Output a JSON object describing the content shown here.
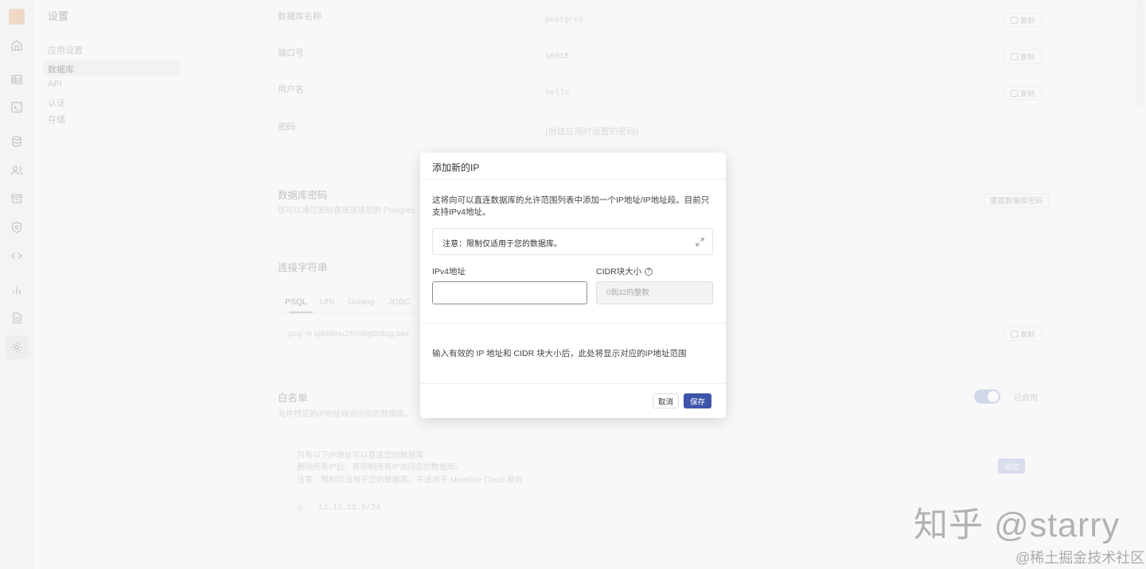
{
  "sidebar": {
    "title": "设置",
    "items": [
      "应用设置",
      "数据库",
      "API",
      "认证",
      "存储"
    ]
  },
  "database": {
    "fields": [
      {
        "label": "数据库名称",
        "value": "postgres"
      },
      {
        "label": "端口号",
        "value": "16018"
      },
      {
        "label": "用户名",
        "value": "hello"
      },
      {
        "label": "密码",
        "value": "(创建应用时设置的密码)"
      }
    ],
    "copy_label": "复制"
  },
  "db_password": {
    "title": "数据库密码",
    "subtitle": "您可以通过密码直接连接您的 Postgres",
    "reset_label": "重置数据库密码"
  },
  "connection": {
    "title": "连接字符串",
    "tabs": [
      "PSQL",
      "URI",
      "Golang",
      "JDBC"
    ],
    "command": "psql -h cj46dmu240sl8g0c8qg.bas"
  },
  "whitelist": {
    "title": "白名单",
    "subtitle": "允许特定的IP地址段访问你的数据库。",
    "enabled_label": "已启用",
    "add_label": "添加",
    "info": [
      "只有以下IP地址可以直连您的数据库",
      "删除所有IP后，将限制所有IP访问您的数据库。",
      "注意：限制仅适用于您的数据库，不适用于 MemFire Cloud 服务"
    ],
    "ips": [
      "12.12.12.0/24"
    ]
  },
  "dialog": {
    "title": "添加新的IP",
    "description": "这将向可以直连数据库的允许范围列表中添加一个IP地址/IP地址段。目前只支持IPv4地址。",
    "note": "注意：限制仅适用于您的数据库。",
    "ipv4_label": "IPv4地址",
    "ipv4_value": "",
    "cidr_label": "CIDR块大小",
    "cidr_placeholder": "0到32的整数",
    "hint": "输入有效的 IP 地址和 CIDR 块大小后，此处将显示对应的IP地址范围",
    "cancel_label": "取消",
    "save_label": "保存"
  },
  "watermark": {
    "line1": "知乎 @starry",
    "line2": "@稀土掘金技术社区"
  }
}
